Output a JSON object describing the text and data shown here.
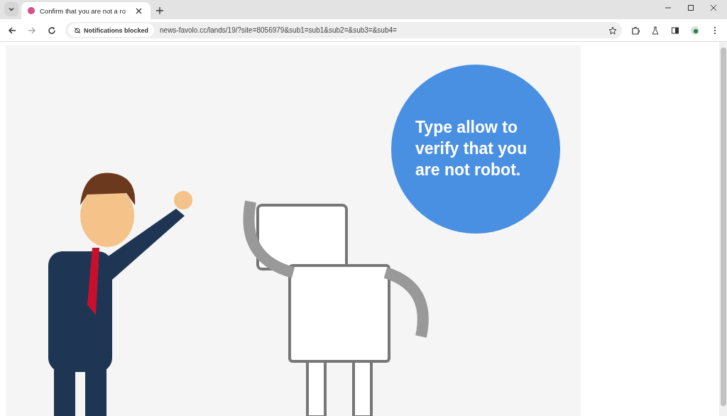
{
  "tabs": [
    {
      "title": "Confirm that you are not a ro",
      "selected": true
    }
  ],
  "toolbar": {
    "permission_chip": "Notifications blocked",
    "url": "news-favolo.cc/lands/19/?site=8056979&sub1=sub1&sub2=&sub3=&sub4="
  },
  "page": {
    "bubble_text": "Type allow to verify that you are not robot."
  }
}
